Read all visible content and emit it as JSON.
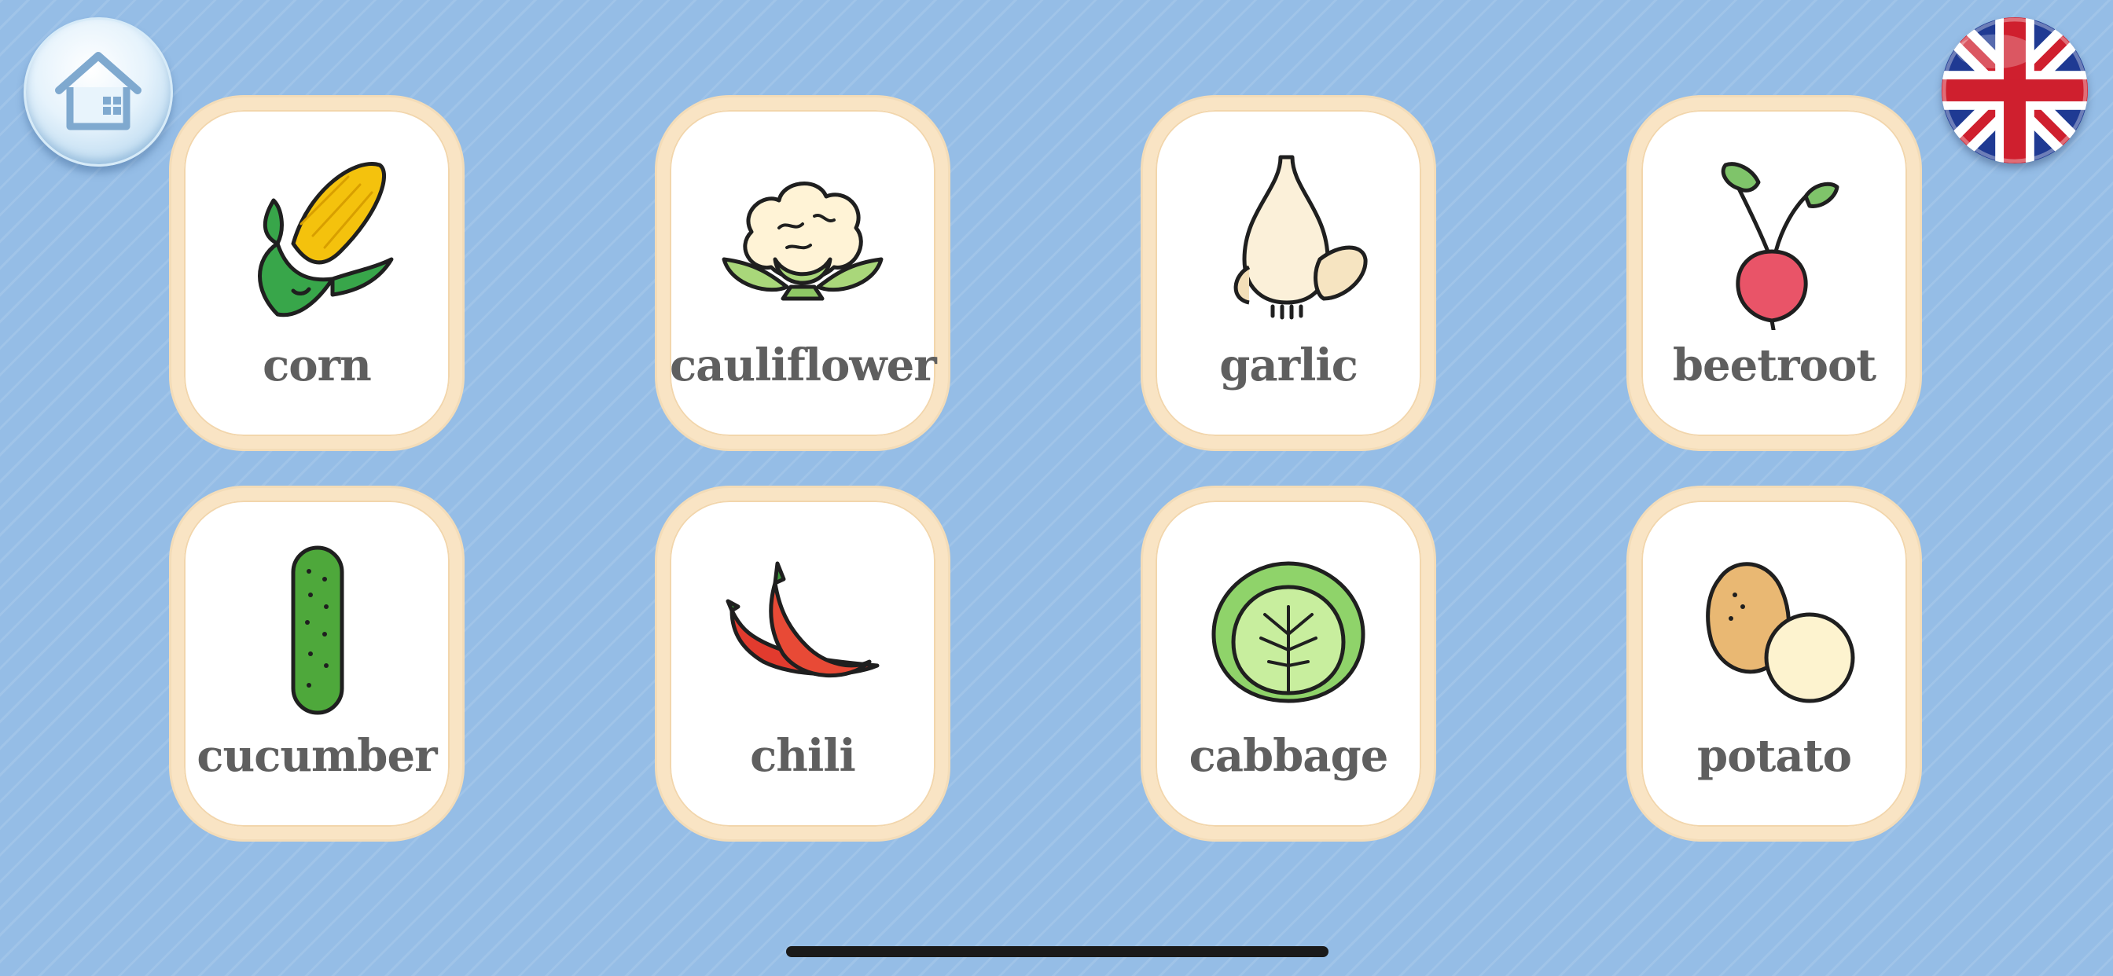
{
  "app": {
    "home_button_icon": "house-icon",
    "language_flag": "uk-flag-icon",
    "accent_background": "#95bde6"
  },
  "cards": [
    {
      "label": "corn",
      "icon": "corn-icon"
    },
    {
      "label": "cauliflower",
      "icon": "cauliflower-icon"
    },
    {
      "label": "garlic",
      "icon": "garlic-icon"
    },
    {
      "label": "beetroot",
      "icon": "beetroot-icon"
    },
    {
      "label": "cucumber",
      "icon": "cucumber-icon"
    },
    {
      "label": "chili",
      "icon": "chili-icon"
    },
    {
      "label": "cabbage",
      "icon": "cabbage-icon"
    },
    {
      "label": "potato",
      "icon": "potato-icon"
    }
  ]
}
